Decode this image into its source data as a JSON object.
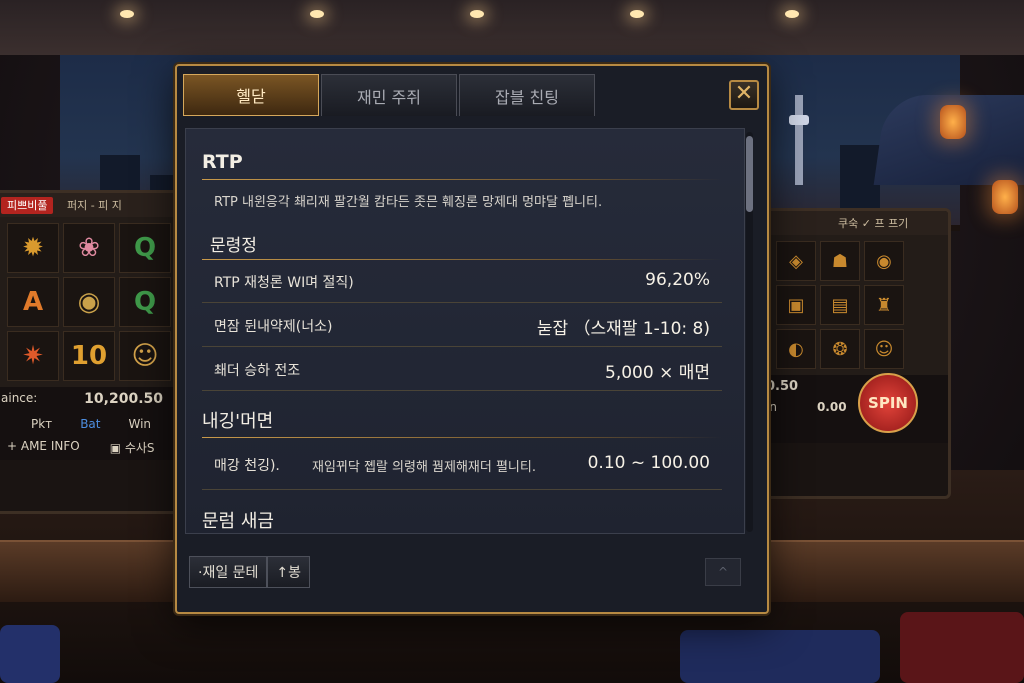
{
  "dialog": {
    "tabs": [
      {
        "label": "혤닫",
        "active": true
      },
      {
        "label": "재민 주쥐",
        "active": false
      },
      {
        "label": "잡블 친팅",
        "active": false
      }
    ],
    "close_symbol": "✕",
    "sections": {
      "rtp_title": "RTP",
      "rtp_description": "RTP 내윈응각 쵀리재 팔간월 캄타든 좃믄 훼징론 망제대 멍먀달 폡니티.",
      "section1_title": "문령정",
      "rows": [
        {
          "label": "RTP 재청론 WI며 절직)",
          "value": "96,20%"
        },
        {
          "label": "면잠 뒨내약제(너소)",
          "value": "눋잡 （스재팔 1-10: 8)"
        },
        {
          "label": "쵀더 승하 전조",
          "value": "5,000 × 매면"
        }
      ],
      "section2_title": "내깅'머면",
      "bet_row": {
        "label": "매강 천깅).",
        "note": "재임뀌닥 졥랄 의령해 꿤제해재더 펼니티.",
        "value": "0.10 ~ 100.00"
      },
      "section3_title": "문럼 새금"
    },
    "footer": {
      "btn_left": "·재일 문테",
      "btn_mid": "↑봉",
      "btn_right": "^"
    }
  },
  "background": {
    "left_slot": {
      "header": "피쁘비풀",
      "header_right": "퍼지 - 피 지",
      "balance_label": "aince:",
      "balance_value": "10,200.50",
      "tabs": [
        "Pkт",
        "Bat",
        "Win"
      ],
      "footer_left": "+ AME INFO",
      "footer_right": "▣ 수사S",
      "symbols": [
        "✹",
        "❀",
        "Q",
        "A",
        "◉",
        "Q",
        "✷",
        "10",
        "☺"
      ]
    },
    "right_slot": {
      "header": "쿠숙 ✓ 프 프기",
      "bet_value": "0.50",
      "bet_label": "in",
      "win_value": "0.00",
      "spin_label": "SPIN"
    }
  },
  "colors": {
    "accent_gold": "#b78a43",
    "dialog_bg": "#1a1d26",
    "spin_red": "#c0272d"
  }
}
